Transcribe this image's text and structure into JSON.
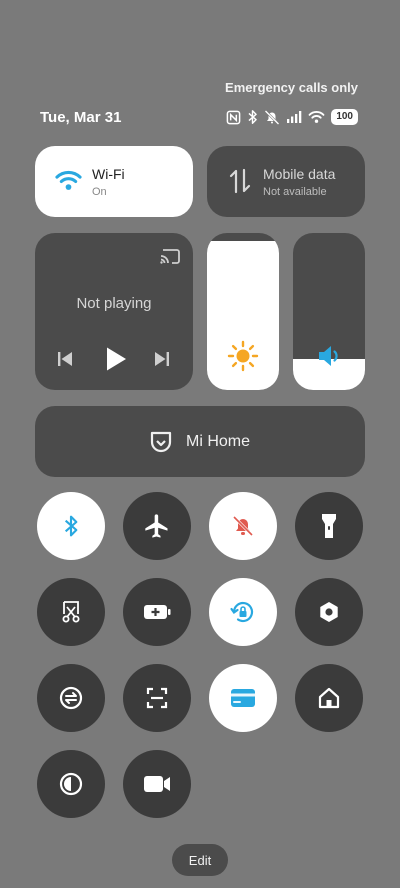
{
  "status": {
    "emergency": "Emergency calls only",
    "date": "Tue, Mar 31",
    "battery": "100"
  },
  "tiles": {
    "wifi": {
      "title": "Wi-Fi",
      "subtitle": "On"
    },
    "mobile_data": {
      "title": "Mobile data",
      "subtitle": "Not available"
    },
    "media": {
      "status": "Not playing"
    },
    "brightness_level": 0.95,
    "volume_level": 0.2,
    "mi_home": "Mi Home"
  },
  "toggles": [
    {
      "name": "bluetooth",
      "on": true
    },
    {
      "name": "airplane-mode",
      "on": false
    },
    {
      "name": "mute",
      "on": true
    },
    {
      "name": "flashlight",
      "on": false
    },
    {
      "name": "screenshot",
      "on": false
    },
    {
      "name": "battery-saver",
      "on": false
    },
    {
      "name": "rotation-lock",
      "on": true
    },
    {
      "name": "settings",
      "on": false
    },
    {
      "name": "data-sync",
      "on": false
    },
    {
      "name": "scanner",
      "on": false
    },
    {
      "name": "cards",
      "on": true
    },
    {
      "name": "home",
      "on": false
    },
    {
      "name": "invert-colors",
      "on": false
    },
    {
      "name": "video-camera",
      "on": false
    }
  ],
  "edit_label": "Edit",
  "colors": {
    "background": "#7a7a7a",
    "tile_dark": "#4b4b4b",
    "toggle_off": "#3b3b3b",
    "toggle_on": "#ffffff",
    "accent": "#29a8e0",
    "sun": "#f5a623",
    "mute_red": "#e05a4f"
  }
}
